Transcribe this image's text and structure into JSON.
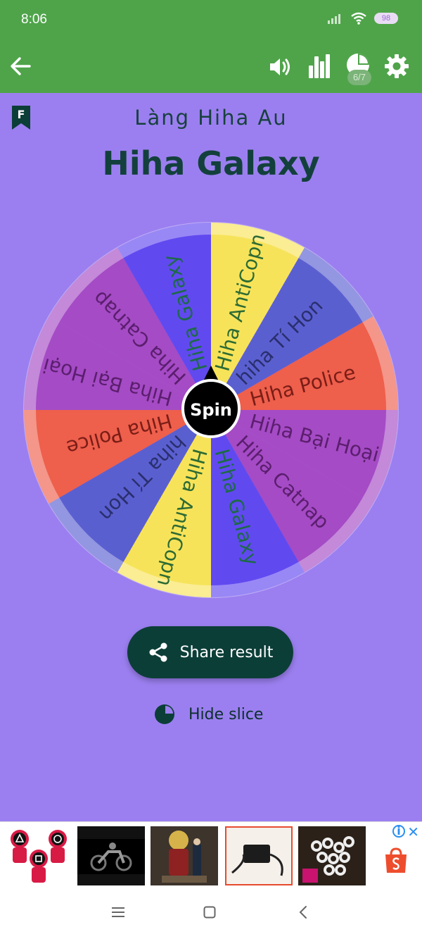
{
  "status": {
    "time": "8:06",
    "battery": "98"
  },
  "app_bar": {
    "slice_count": "6/7"
  },
  "header": {
    "subtitle": "Làng Hiha Au",
    "title": "Hiha Galaxy",
    "bookmark_letter": "F"
  },
  "wheel": {
    "spin_label": "Spin",
    "slices": [
      {
        "label": "Hiha AntiCopn",
        "color": "#f7e35a",
        "text_color": "#2d6b34"
      },
      {
        "label": "hiha Tí Hon",
        "color": "#5a5fd0",
        "text_color": "#2a2f6e"
      },
      {
        "label": "Hiha Police",
        "color": "#ee5f4c",
        "text_color": "#7a1d16"
      },
      {
        "label": "Hiha Bại Hoại",
        "color": "#a54bc5",
        "text_color": "#5b1e6e"
      },
      {
        "label": "Hiha Catnap",
        "color": "#a54bc5",
        "text_color": "#5b1e6e"
      },
      {
        "label": "Hiha Galaxy",
        "color": "#6149f0",
        "text_color": "#1c6a47"
      },
      {
        "label": "Hiha AntiCopn",
        "color": "#f7e35a",
        "text_color": "#2d6b34"
      },
      {
        "label": "hiha Tí Hon",
        "color": "#5a5fd0",
        "text_color": "#2a2f6e"
      },
      {
        "label": "Hiha Police",
        "color": "#ee5f4c",
        "text_color": "#7a1d16"
      },
      {
        "label": "Hiha Bại Hoại",
        "color": "#a54bc5",
        "text_color": "#5b1e6e"
      },
      {
        "label": "Hiha Catnap",
        "color": "#a54bc5",
        "text_color": "#5b1e6e"
      },
      {
        "label": "Hiha Galaxy",
        "color": "#6149f0",
        "text_color": "#1c6a47"
      }
    ]
  },
  "actions": {
    "share_label": "Share result",
    "hide_label": "Hide slice"
  },
  "colors": {
    "app_bar": "#4fa44a",
    "background": "#9b7ff0",
    "button": "#0c3e38"
  }
}
